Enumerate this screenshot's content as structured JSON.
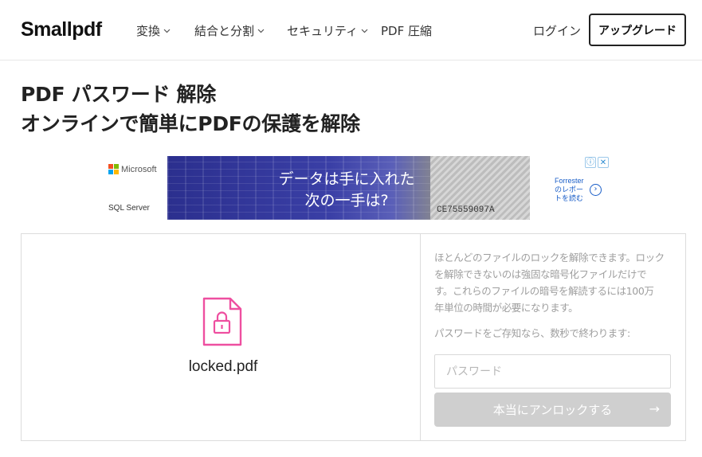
{
  "header": {
    "logo": "Smallpdf",
    "nav": [
      {
        "label": "変換",
        "chevron": true
      },
      {
        "label": "結合と分割",
        "chevron": true
      },
      {
        "label": "セキュリティ",
        "chevron": true
      },
      {
        "label": "PDF 圧縮",
        "chevron": false
      }
    ],
    "login": "ログイン",
    "upgrade": "アップグレード"
  },
  "title": {
    "line1": "PDF パスワード 解除",
    "line2": "オンラインで簡単にPDFの保護を解除"
  },
  "ad": {
    "brand": "Microsoft",
    "product": "SQL Server",
    "headline_line1": "データは手に入れた",
    "headline_line2": "次の一手は?",
    "bill_serial": "CE75559097A",
    "partner_lines": [
      "Forrester",
      "のレポー",
      "トを読む"
    ],
    "choices": [
      "ⓘ",
      "✕"
    ],
    "colors": {
      "ms_red": "#f25022",
      "ms_green": "#7fba00",
      "ms_blue": "#00a4ef",
      "ms_yellow": "#ffb900",
      "link": "#1a5ec8"
    }
  },
  "file": {
    "name": "locked.pdf",
    "icon": "locked-file-icon",
    "icon_color": "#ee4fa0"
  },
  "unlock_panel": {
    "description_lines": [
      "ほとんどのファイルのロックを解除できます。ロック",
      "を解除できないのは強固な暗号化ファイルだけで",
      "す。これらのファイルの暗号を解読するには100万",
      "年単位の時間が必要になります。"
    ],
    "hint": "パスワードをご存知なら、数秒で終わります:",
    "password_value": "",
    "password_placeholder": "パスワード",
    "button_label": "本当にアンロックする",
    "button_arrow": "→",
    "button_color": "#cfcfcf"
  }
}
